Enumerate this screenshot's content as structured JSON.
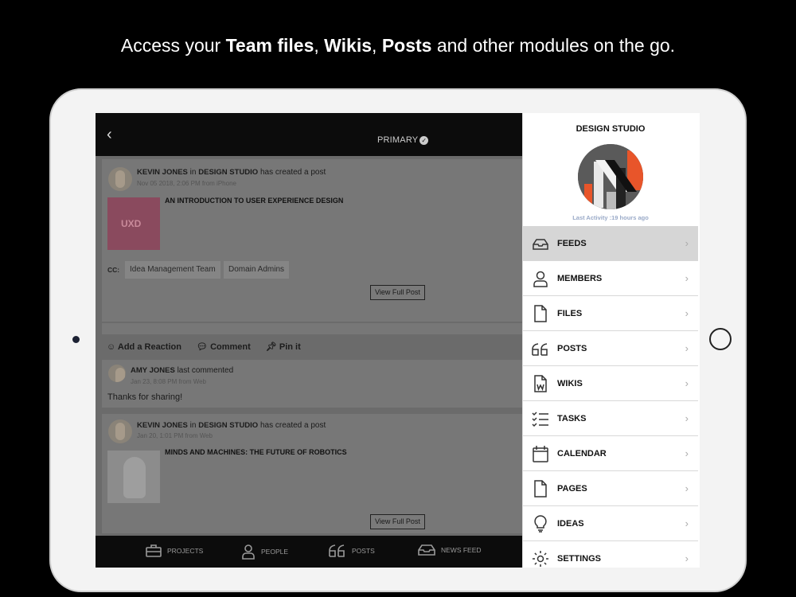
{
  "headline": {
    "pre": "Access your ",
    "b1": "Team files",
    "sep1": ", ",
    "b2": "Wikis",
    "sep2": ", ",
    "b3": "Posts",
    "post": " and other modules on the go."
  },
  "topbar": {
    "title": "PRIMARY"
  },
  "posts": [
    {
      "author": "KEVIN JONES",
      "in": "in",
      "space": "DESIGN STUDIO",
      "action": "has created a post",
      "meta": "Nov 05 2018, 2:06 PM from iPhone",
      "title": "AN INTRODUCTION TO USER EXPERIENCE DESIGN",
      "thumb_text": "UXD",
      "cc_label": "CC:",
      "cc_tags": [
        "Idea Management Team",
        "Domain Admins"
      ],
      "view_label": "View Full Post"
    },
    {
      "author": "KEVIN JONES",
      "in": "in",
      "space": "DESIGN STUDIO",
      "action": "has created a post",
      "meta": "Jan 20, 1:01 PM from Web",
      "title": "MINDS AND MACHINES: THE FUTURE OF ROBOTICS",
      "view_label": "View Full Post"
    }
  ],
  "actions": {
    "reaction": "Add a Reaction",
    "comment": "Comment",
    "pin": "Pin it"
  },
  "comment": {
    "author": "AMY JONES",
    "action": "last commented",
    "meta": "Jan 23, 8:08 PM from Web",
    "text": "Thanks for sharing!"
  },
  "tabbar": [
    "PROJECTS",
    "PEOPLE",
    "POSTS",
    "NEWS FEED"
  ],
  "drawer": {
    "title": "DESIGN STUDIO",
    "last_activity": "Last Activity :19 hours ago",
    "items": [
      "FEEDS",
      "MEMBERS",
      "FILES",
      "POSTS",
      "WIKIS",
      "TASKS",
      "CALENDAR",
      "PAGES",
      "IDEAS",
      "SETTINGS"
    ],
    "icons": [
      "inbox-icon",
      "user-icon",
      "file-icon",
      "quote-icon",
      "wiki-icon",
      "tasks-icon",
      "calendar-icon",
      "page-icon",
      "idea-icon",
      "gear-icon"
    ]
  },
  "colors": {
    "accent": "#e8552a",
    "dim": "#777777",
    "active_item": "#d6d6d6"
  }
}
